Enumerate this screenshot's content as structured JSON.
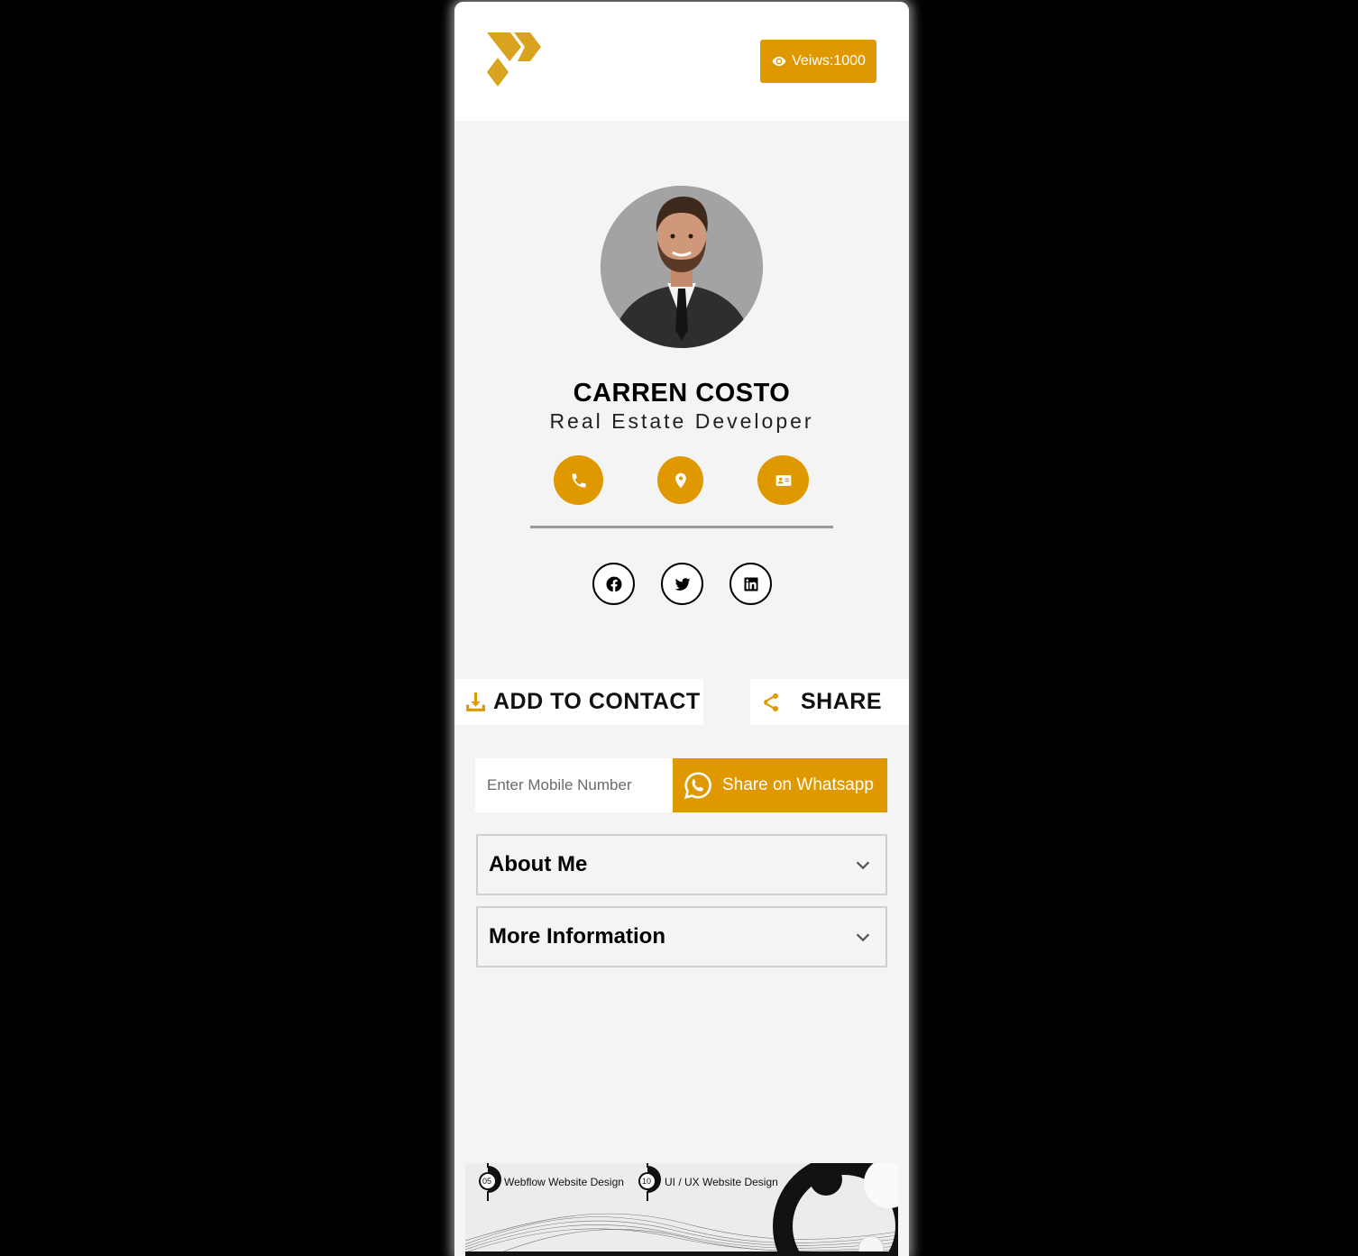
{
  "header": {
    "views_label": "Veiws:1000"
  },
  "profile": {
    "name": "CARREN COSTO",
    "title": "Real Estate Developer"
  },
  "actions": {
    "add_contact": "ADD TO CONTACT",
    "share": "SHARE"
  },
  "whatsapp": {
    "placeholder": "Enter Mobile Number",
    "button_label": "Share on Whatsapp"
  },
  "accordions": [
    {
      "label": "About Me"
    },
    {
      "label": "More Information"
    }
  ],
  "banner": {
    "item1_num": "05",
    "item1_label": "Webflow Website Design",
    "item2_num": "10",
    "item2_label": "UI / UX Website Design"
  },
  "colors": {
    "accent": "#df9800",
    "page_bg": "#000000",
    "card_bg": "#f4f4f4"
  }
}
